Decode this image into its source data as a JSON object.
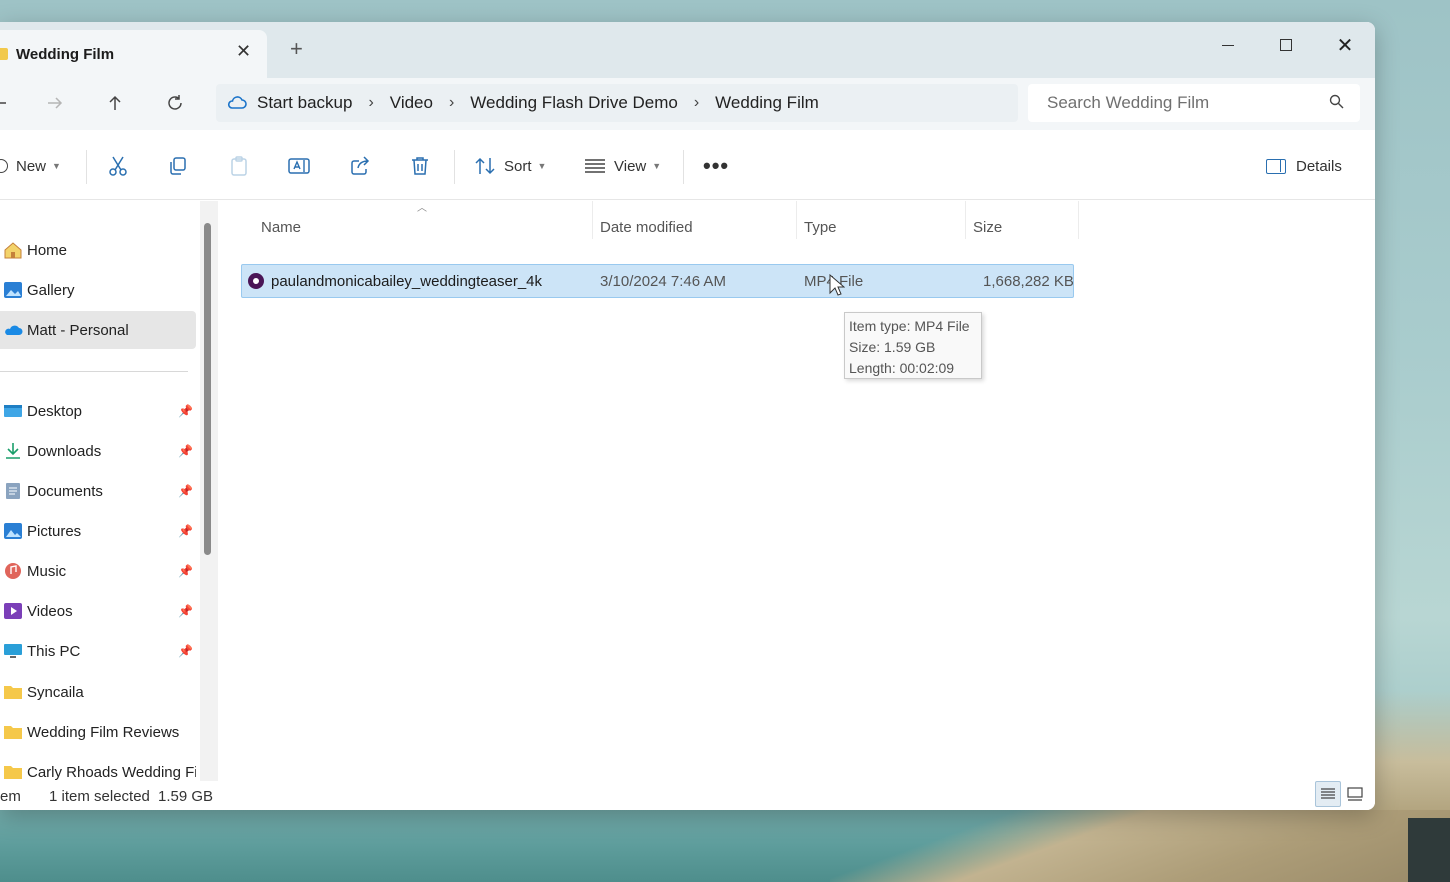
{
  "window": {
    "tab_title": "Wedding Film",
    "tab_close": "✕",
    "tab_add": "+"
  },
  "nav": {
    "breadcrumbs": [
      "Start backup",
      "Video",
      "Wedding Flash Drive Demo",
      "Wedding Film"
    ],
    "search_placeholder": "Search Wedding Film"
  },
  "toolbar": {
    "new_label": "New",
    "sort_label": "Sort",
    "view_label": "View",
    "more_label": "•••",
    "details_label": "Details",
    "icons": [
      "cut-icon",
      "copy-icon",
      "paste-icon",
      "rename-icon",
      "share-icon",
      "delete-icon"
    ]
  },
  "sidebar": {
    "top": [
      {
        "label": "Home",
        "icon": "home-icon"
      },
      {
        "label": "Gallery",
        "icon": "gallery-icon"
      },
      {
        "label": "Matt - Personal",
        "icon": "onedrive-icon",
        "selected": true
      }
    ],
    "pinned": [
      {
        "label": "Desktop",
        "icon": "desktop-icon"
      },
      {
        "label": "Downloads",
        "icon": "downloads-icon"
      },
      {
        "label": "Documents",
        "icon": "documents-icon"
      },
      {
        "label": "Pictures",
        "icon": "pictures-icon"
      },
      {
        "label": "Music",
        "icon": "music-icon"
      },
      {
        "label": "Videos",
        "icon": "videos-icon"
      },
      {
        "label": "This PC",
        "icon": "this-pc-icon"
      }
    ],
    "folders": [
      {
        "label": "Syncaila",
        "icon": "folder-icon"
      },
      {
        "label": "Wedding Film Reviews",
        "icon": "folder-icon"
      },
      {
        "label": "Carly Rhoads Wedding Fil",
        "icon": "folder-icon"
      }
    ]
  },
  "columns": {
    "name": "Name",
    "date": "Date modified",
    "type": "Type",
    "size": "Size"
  },
  "files": [
    {
      "name": "paulandmonicabailey_weddingteaser_4k",
      "date": "3/10/2024 7:46 AM",
      "type": "MP4 File",
      "size": "1,668,282 KB"
    }
  ],
  "tooltip": {
    "line1": "Item type: MP4 File",
    "line2": "Size: 1.59 GB",
    "line3": "Length: 00:02:09"
  },
  "status": {
    "items": "em",
    "selection": "1 item selected",
    "size": "1.59 GB"
  }
}
